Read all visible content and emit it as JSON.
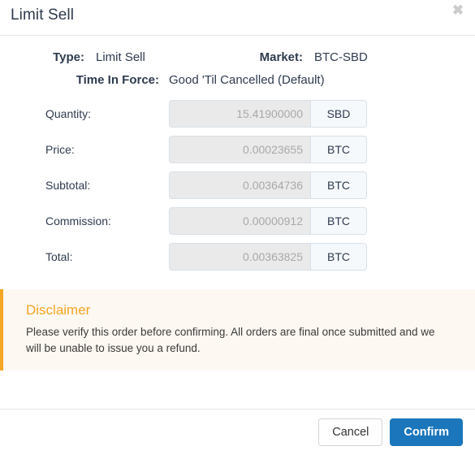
{
  "modal": {
    "title": "Limit Sell",
    "close_icon": "close-icon",
    "close_glyph": "✖"
  },
  "summary": {
    "type_label": "Type:",
    "type_value": "Limit Sell",
    "market_label": "Market:",
    "market_value": "BTC-SBD",
    "tif_label": "Time In Force:",
    "tif_value": "Good 'Til Cancelled (Default)"
  },
  "fields": [
    {
      "label": "Quantity:",
      "value": "15.41900000",
      "unit": "SBD"
    },
    {
      "label": "Price:",
      "value": "0.00023655",
      "unit": "BTC"
    },
    {
      "label": "Subtotal:",
      "value": "0.00364736",
      "unit": "BTC"
    },
    {
      "label": "Commission:",
      "value": "0.00000912",
      "unit": "BTC"
    },
    {
      "label": "Total:",
      "value": "0.00363825",
      "unit": "BTC"
    }
  ],
  "disclaimer": {
    "title": "Disclaimer",
    "text": "Please verify this order before confirming. All orders are final once submitted and we will be unable to issue you a refund."
  },
  "footer": {
    "cancel_label": "Cancel",
    "confirm_label": "Confirm"
  },
  "colors": {
    "primary": "#1b76bc",
    "warning": "#f5a623",
    "warning_bg": "#fdf8f2",
    "text": "#2e3b4e",
    "input_bg": "#eaeaea",
    "addon_bg": "#f6f9fc"
  }
}
